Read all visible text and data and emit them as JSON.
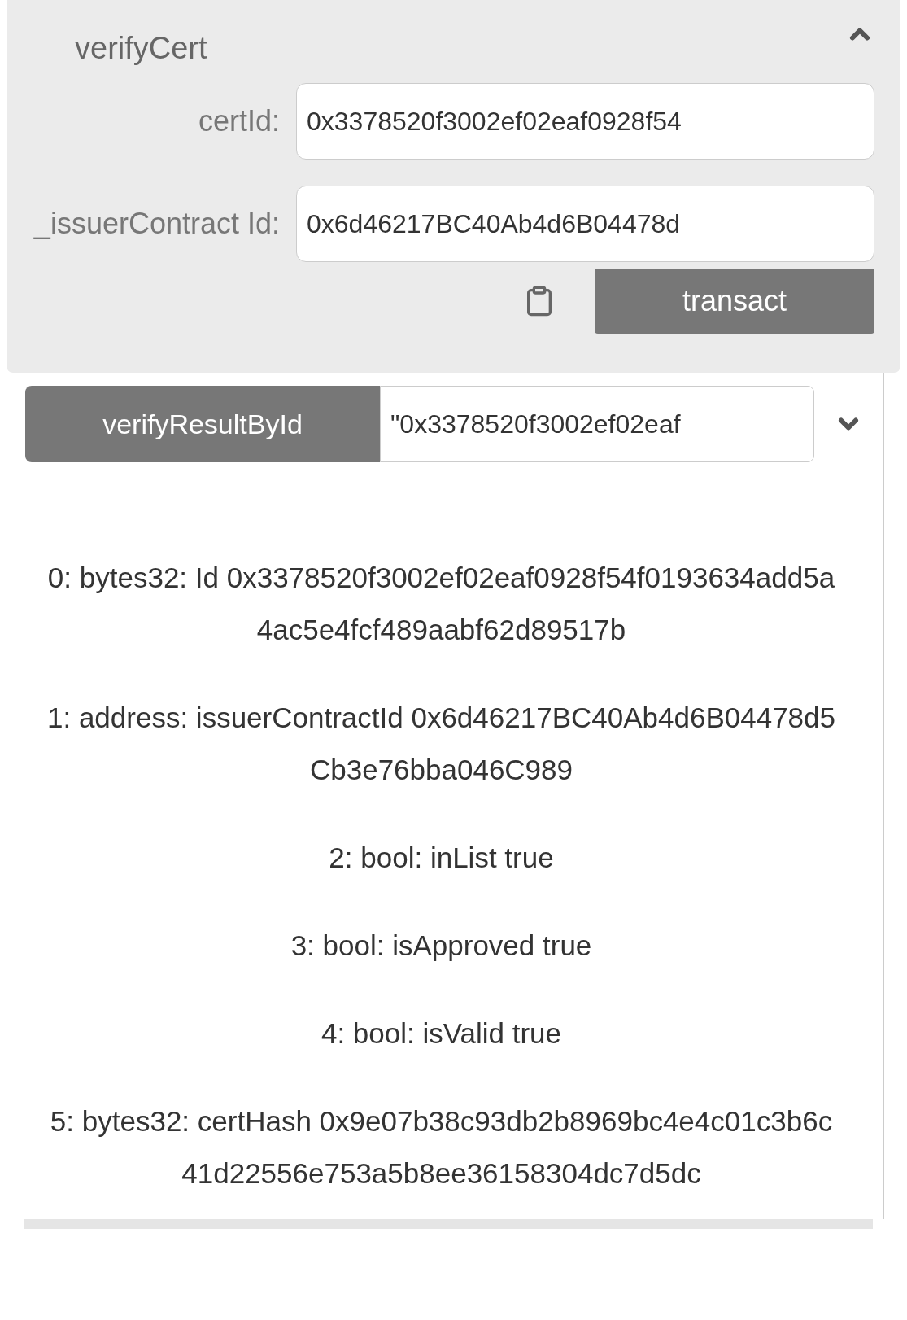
{
  "function_panel": {
    "title": "verifyCert",
    "expanded": true,
    "inputs": [
      {
        "label": "certId:",
        "value": "0x3378520f3002ef02eaf0928f54"
      },
      {
        "label": "_issuerContract Id:",
        "value": "0x6d46217BC40Ab4d6B04478d"
      }
    ],
    "button": "transact"
  },
  "call": {
    "button": "verifyResultById",
    "value": "\"0x3378520f3002ef02eaf",
    "expanded": true
  },
  "results": [
    "0: bytes32: Id 0x3378520f3002ef02eaf0928f54f0193634add5a4ac5e4fcf489aabf62d89517b",
    "1: address: issuerContractId 0x6d46217BC40Ab4d6B04478d5Cb3e76bba046C989",
    "2: bool: inList true",
    "3: bool: isApproved true",
    "4: bool: isValid true",
    "5: bytes32: certHash 0x9e07b38c93db2b8969bc4e4c01c3b6c41d22556e753a5b8ee36158304dc7d5dc"
  ]
}
